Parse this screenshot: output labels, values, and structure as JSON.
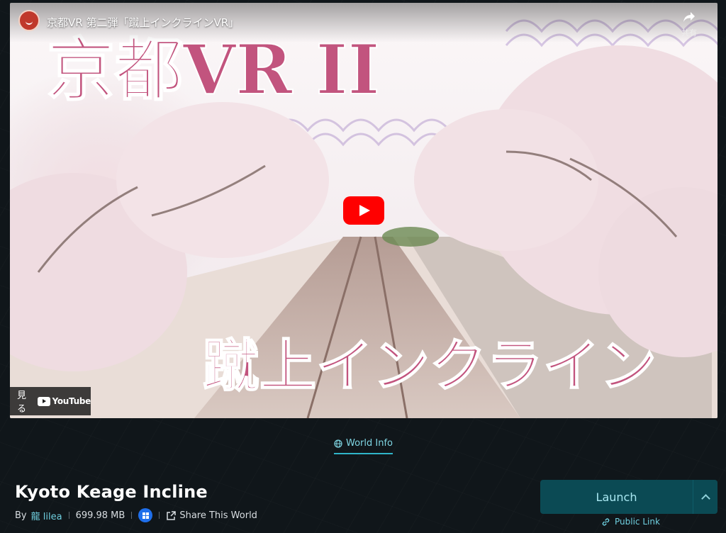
{
  "video": {
    "title": "京都VR 第二弾「蹴上インクラインVR」",
    "share_label": "共有",
    "watch_on_label": "見る",
    "platform_name": "YouTube",
    "thumbnail_title": "京都VR II",
    "thumbnail_subtitle": "蹴上インクライン"
  },
  "tabs": [
    {
      "label": "World Info",
      "icon": "globe-icon",
      "active": true
    }
  ],
  "world": {
    "title": "Kyoto Keage Incline",
    "by_label": "By",
    "author": "龍 lilea",
    "size": "699.98 MB",
    "platform_icon": "windows-icon",
    "share_label": "Share This World"
  },
  "actions": {
    "launch_label": "Launch",
    "public_link_label": "Public Link"
  },
  "colors": {
    "accent": "#2fb5c9",
    "launch_bg": "#0b4a54",
    "youtube_red": "#ff0000",
    "title_pink": "#c2547e"
  }
}
